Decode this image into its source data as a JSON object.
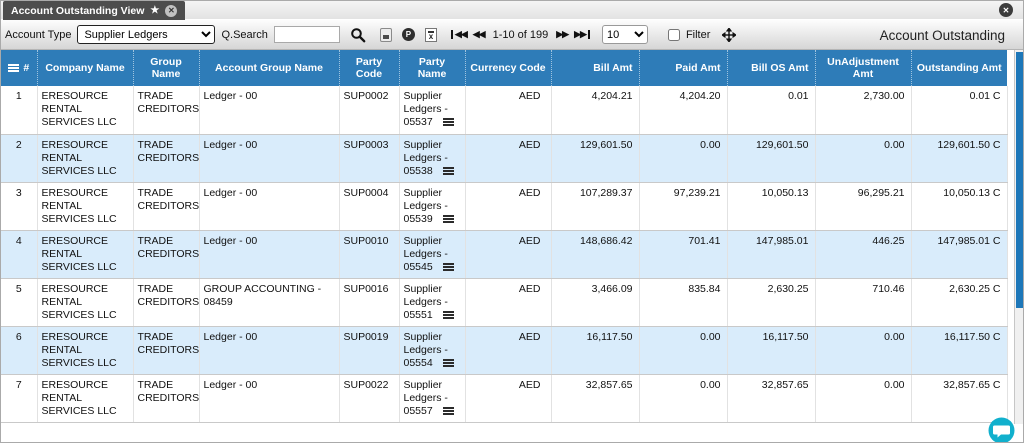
{
  "window": {
    "tab_title": "Account Outstanding View",
    "page_title": "Account Outstanding"
  },
  "icons": {
    "star": "★",
    "close": "✕",
    "prev_double": "◀◀",
    "next_double": "▶▶"
  },
  "toolbar": {
    "account_type_label": "Account Type",
    "account_type_value": "Supplier Ledgers",
    "search_label": "Q.Search",
    "search_value": "",
    "pagination_text": "1-10 of 199",
    "page_size": "10",
    "filter_label": "Filter"
  },
  "table": {
    "columns": [
      "#",
      "Company Name",
      "Group Name",
      "Account Group Name",
      "Party Code",
      "Party Name",
      "Currency Code",
      "Bill Amt",
      "Paid Amt",
      "Bill OS Amt",
      "UnAdjustment Amt",
      "Outstanding Amt"
    ],
    "rows": [
      {
        "num": "1",
        "company": "ERESOURCE RENTAL SERVICES LLC",
        "group": "TRADE CREDITORS",
        "account_group": "Ledger - 00",
        "party_code": "SUP0002",
        "party_name": "Supplier Ledgers - 05537",
        "currency": "AED",
        "bill_amt": "4,204.21",
        "paid_amt": "4,204.20",
        "bill_os_amt": "0.01",
        "unadjustment_amt": "2,730.00",
        "outstanding_amt": "0.01 C"
      },
      {
        "num": "2",
        "company": "ERESOURCE RENTAL SERVICES LLC",
        "group": "TRADE CREDITORS",
        "account_group": "Ledger - 00",
        "party_code": "SUP0003",
        "party_name": "Supplier Ledgers - 05538",
        "currency": "AED",
        "bill_amt": "129,601.50",
        "paid_amt": "0.00",
        "bill_os_amt": "129,601.50",
        "unadjustment_amt": "0.00",
        "outstanding_amt": "129,601.50 C"
      },
      {
        "num": "3",
        "company": "ERESOURCE RENTAL SERVICES LLC",
        "group": "TRADE CREDITORS",
        "account_group": "Ledger - 00",
        "party_code": "SUP0004",
        "party_name": "Supplier Ledgers - 05539",
        "currency": "AED",
        "bill_amt": "107,289.37",
        "paid_amt": "97,239.21",
        "bill_os_amt": "10,050.13",
        "unadjustment_amt": "96,295.21",
        "outstanding_amt": "10,050.13 C"
      },
      {
        "num": "4",
        "company": "ERESOURCE RENTAL SERVICES LLC",
        "group": "TRADE CREDITORS",
        "account_group": "Ledger - 00",
        "party_code": "SUP0010",
        "party_name": "Supplier Ledgers - 05545",
        "currency": "AED",
        "bill_amt": "148,686.42",
        "paid_amt": "701.41",
        "bill_os_amt": "147,985.01",
        "unadjustment_amt": "446.25",
        "outstanding_amt": "147,985.01 C"
      },
      {
        "num": "5",
        "company": "ERESOURCE RENTAL SERVICES LLC",
        "group": "TRADE CREDITORS",
        "account_group": "GROUP ACCOUNTING - 08459",
        "party_code": "SUP0016",
        "party_name": "Supplier Ledgers - 05551",
        "currency": "AED",
        "bill_amt": "3,466.09",
        "paid_amt": "835.84",
        "bill_os_amt": "2,630.25",
        "unadjustment_amt": "710.46",
        "outstanding_amt": "2,630.25 C"
      },
      {
        "num": "6",
        "company": "ERESOURCE RENTAL SERVICES LLC",
        "group": "TRADE CREDITORS",
        "account_group": "Ledger - 00",
        "party_code": "SUP0019",
        "party_name": "Supplier Ledgers - 05554",
        "currency": "AED",
        "bill_amt": "16,117.50",
        "paid_amt": "0.00",
        "bill_os_amt": "16,117.50",
        "unadjustment_amt": "0.00",
        "outstanding_amt": "16,117.50 C"
      },
      {
        "num": "7",
        "company": "ERESOURCE RENTAL SERVICES LLC",
        "group": "TRADE CREDITORS",
        "account_group": "Ledger - 00",
        "party_code": "SUP0022",
        "party_name": "Supplier Ledgers - 05557",
        "currency": "AED",
        "bill_amt": "32,857.65",
        "paid_amt": "0.00",
        "bill_os_amt": "32,857.65",
        "unadjustment_amt": "0.00",
        "outstanding_amt": "32,857.65 C"
      }
    ]
  },
  "colors": {
    "header_blue": "#2e7cb8",
    "row_alt": "#d9ecfb",
    "scroll_thumb": "#1d77b9",
    "chat_teal": "#11b0cd",
    "tab_bg": "#4d4d4d"
  }
}
